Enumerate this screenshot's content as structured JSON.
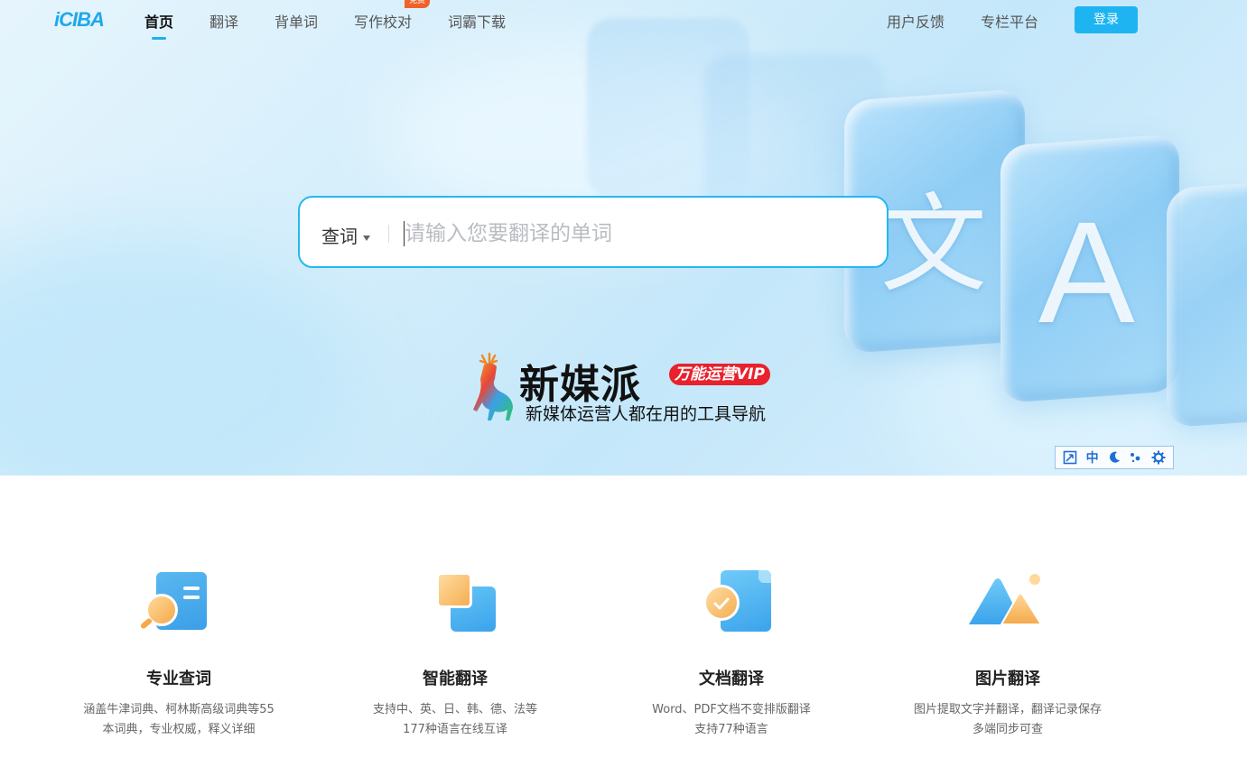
{
  "nav": {
    "logo": "iCIBA",
    "items": [
      {
        "label": "首页"
      },
      {
        "label": "翻译"
      },
      {
        "label": "背单词"
      },
      {
        "label": "写作校对"
      },
      {
        "label": "词霸下载"
      }
    ],
    "badge": "免费",
    "right_items": [
      {
        "label": "用户反馈"
      },
      {
        "label": "专栏平台"
      }
    ],
    "login": "登录"
  },
  "hero": {
    "glyph_wen": "文",
    "glyph_a": "A"
  },
  "search": {
    "mode": "查词",
    "placeholder": "请输入您要翻译的单词",
    "value": ""
  },
  "ad": {
    "title": "新媒派",
    "tag": "万能运营VIP",
    "subtitle": "新媒体运营人都在用的工具导航"
  },
  "tools": {
    "lang": "中"
  },
  "features": [
    {
      "title": "专业查词",
      "desc1": "涵盖牛津词典、柯林斯高级词典等55",
      "desc2": "本词典，专业权威，释义详细"
    },
    {
      "title": "智能翻译",
      "desc1": "支持中、英、日、韩、德、法等",
      "desc2": "177种语言在线互译"
    },
    {
      "title": "文档翻译",
      "desc1": "Word、PDF文档不变排版翻译",
      "desc2": "支持77种语言"
    },
    {
      "title": "图片翻译",
      "desc1": "图片提取文字并翻译，翻译记录保存",
      "desc2": "多端同步可查"
    }
  ],
  "colors": {
    "accent": "#1eb4f2",
    "badge": "#f0622a",
    "ad_tag": "#e8212d"
  }
}
